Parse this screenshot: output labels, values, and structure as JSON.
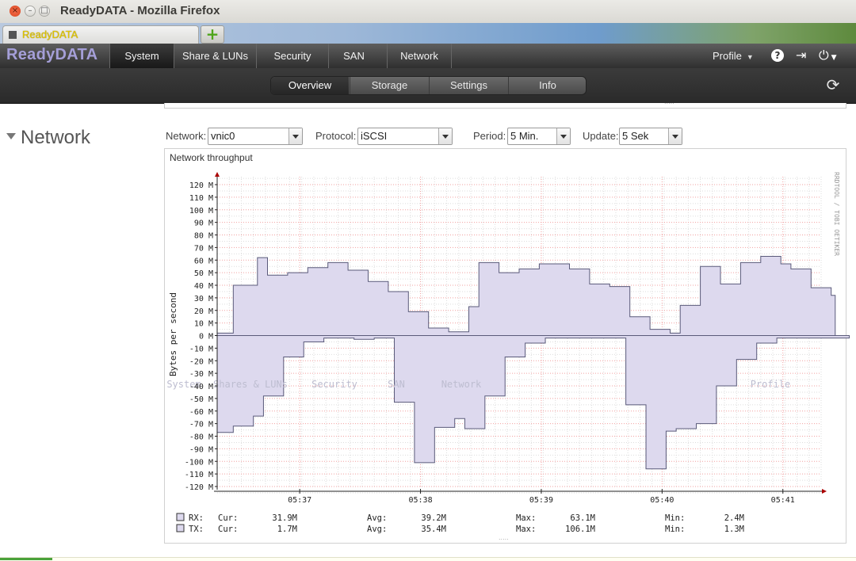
{
  "window": {
    "title": "ReadyDATA - Mozilla Firefox",
    "close_icon": "×",
    "min_icon": "–",
    "max_icon": "□"
  },
  "browser": {
    "tab_label": "ReadyDATA",
    "new_tab_icon": "+"
  },
  "app": {
    "logo": "ReadyDATA",
    "nav": [
      {
        "label": "System",
        "active": true
      },
      {
        "label": "Share & LUNs",
        "active": false
      },
      {
        "label": "Security",
        "active": false
      },
      {
        "label": "SAN",
        "active": false
      },
      {
        "label": "Network",
        "active": false
      }
    ],
    "profile_label": "Profile",
    "icons": {
      "help": "?",
      "logout": "⇥",
      "power": "⏻",
      "refresh": "⟳"
    }
  },
  "subnav": [
    {
      "label": "Overview",
      "active": true
    },
    {
      "label": "Storage",
      "active": false
    },
    {
      "label": "Settings",
      "active": false
    },
    {
      "label": "Info",
      "active": false
    }
  ],
  "section": {
    "title": "Network"
  },
  "controls": {
    "network": {
      "label": "Network:",
      "value": "vnic0"
    },
    "protocol": {
      "label": "Protocol:",
      "value": "iSCSI"
    },
    "period": {
      "label": "Period:",
      "value": "5 Min."
    },
    "update": {
      "label": "Update:",
      "value": "5 Sek"
    }
  },
  "graph": {
    "title": "Network throughput",
    "side_label": "RRDTOOL / TOBI OETIKER",
    "grip": "....."
  },
  "chart_data": {
    "type": "area",
    "ylabel": "Bytes per second",
    "ylim": [
      -125,
      125
    ],
    "y_ticks": [
      120,
      110,
      100,
      90,
      80,
      70,
      60,
      50,
      40,
      30,
      20,
      10,
      0,
      -10,
      -20,
      -30,
      -40,
      -50,
      -60,
      -70,
      -80,
      -90,
      -100,
      -110,
      -120
    ],
    "y_tick_suffix": " M",
    "x_range": [
      0,
      300
    ],
    "x_ticks": [
      {
        "x": 41,
        "label": "05:37"
      },
      {
        "x": 101,
        "label": "05:38"
      },
      {
        "x": 161,
        "label": "05:39"
      },
      {
        "x": 221,
        "label": "05:40"
      },
      {
        "x": 281,
        "label": "05:41"
      }
    ],
    "fill_color": "#ddd9ee",
    "line_color": "#5a5a7a",
    "series": [
      {
        "name": "RX",
        "values": [
          2,
          2,
          2,
          2,
          2,
          2,
          2,
          2,
          40,
          40,
          40,
          40,
          40,
          40,
          40,
          40,
          40,
          40,
          40,
          40,
          62,
          62,
          62,
          62,
          62,
          48,
          48,
          48,
          48,
          48,
          48,
          48,
          48,
          48,
          48,
          50,
          50,
          50,
          50,
          50,
          50,
          50,
          50,
          50,
          50,
          54,
          54,
          54,
          54,
          54,
          54,
          54,
          54,
          54,
          54,
          58,
          58,
          58,
          58,
          58,
          58,
          58,
          58,
          58,
          58,
          52,
          52,
          52,
          52,
          52,
          52,
          52,
          52,
          52,
          52,
          43,
          43,
          43,
          43,
          43,
          43,
          43,
          43,
          43,
          43,
          35,
          35,
          35,
          35,
          35,
          35,
          35,
          35,
          35,
          35,
          19,
          19,
          19,
          19,
          19,
          19,
          19,
          19,
          19,
          19,
          6,
          6,
          6,
          6,
          6,
          6,
          6,
          6,
          6,
          6,
          3,
          3,
          3,
          3,
          3,
          3,
          3,
          3,
          3,
          3,
          23,
          23,
          23,
          23,
          23,
          58,
          58,
          58,
          58,
          58,
          58,
          58,
          58,
          58,
          58,
          50,
          50,
          50,
          50,
          50,
          50,
          50,
          50,
          50,
          50,
          53,
          53,
          53,
          53,
          53,
          53,
          53,
          53,
          53,
          53,
          57,
          57,
          57,
          57,
          57,
          57,
          57,
          57,
          57,
          57,
          57,
          57,
          57,
          57,
          57,
          53,
          53,
          53,
          53,
          53,
          53,
          53,
          53,
          53,
          53,
          41,
          41,
          41,
          41,
          41,
          41,
          41,
          41,
          41,
          41,
          39,
          39,
          39,
          39,
          39,
          39,
          39,
          39,
          39,
          39,
          15,
          15,
          15,
          15,
          15,
          15,
          15,
          15,
          15,
          15,
          5,
          5,
          5,
          5,
          5,
          5,
          5,
          5,
          5,
          5,
          2,
          2,
          2,
          2,
          2,
          24,
          24,
          24,
          24,
          24,
          24,
          24,
          24,
          24,
          24,
          55,
          55,
          55,
          55,
          55,
          55,
          55,
          55,
          55,
          55,
          41,
          41,
          41,
          41,
          41,
          41,
          41,
          41,
          41,
          41,
          58,
          58,
          58,
          58,
          58,
          58,
          58,
          58,
          58,
          58,
          63,
          63,
          63,
          63,
          63,
          63,
          63,
          63,
          63,
          63,
          57,
          57,
          57,
          57,
          57,
          53,
          53,
          53,
          53,
          53,
          53,
          53,
          53,
          53,
          53,
          38,
          38,
          38,
          38,
          38,
          38,
          38,
          38,
          38,
          38,
          32,
          32
        ]
      },
      {
        "name": "TX",
        "values": [
          77,
          77,
          77,
          77,
          77,
          77,
          77,
          77,
          72,
          72,
          72,
          72,
          72,
          72,
          72,
          72,
          72,
          72,
          64,
          64,
          64,
          64,
          64,
          48,
          48,
          48,
          48,
          48,
          48,
          48,
          48,
          48,
          48,
          17,
          17,
          17,
          17,
          17,
          17,
          17,
          17,
          17,
          17,
          5,
          5,
          5,
          5,
          5,
          5,
          5,
          5,
          5,
          5,
          2,
          2,
          2,
          2,
          2,
          2,
          2,
          2,
          2,
          2,
          2,
          2,
          2,
          2,
          2,
          3,
          3,
          3,
          3,
          3,
          3,
          3,
          3,
          3,
          3,
          2,
          2,
          2,
          2,
          2,
          2,
          2,
          2,
          2,
          2,
          53,
          53,
          53,
          53,
          53,
          53,
          53,
          53,
          53,
          53,
          101,
          101,
          101,
          101,
          101,
          101,
          101,
          101,
          101,
          101,
          73,
          73,
          73,
          73,
          73,
          73,
          73,
          73,
          73,
          73,
          66,
          66,
          66,
          66,
          66,
          74,
          74,
          74,
          74,
          74,
          74,
          74,
          74,
          74,
          74,
          48,
          48,
          48,
          48,
          48,
          48,
          48,
          48,
          48,
          48,
          17,
          17,
          17,
          17,
          17,
          17,
          17,
          17,
          17,
          17,
          6,
          6,
          6,
          6,
          6,
          6,
          6,
          6,
          6,
          6,
          2,
          2,
          2,
          2,
          2,
          2,
          2,
          2,
          2,
          2,
          2,
          2,
          2,
          2,
          2,
          2,
          2,
          2,
          2,
          2,
          2,
          2,
          2,
          2,
          2,
          2,
          2,
          2,
          2,
          2,
          2,
          2,
          2,
          2,
          2,
          2,
          2,
          2,
          2,
          2,
          55,
          55,
          55,
          55,
          55,
          55,
          55,
          55,
          55,
          55,
          106,
          106,
          106,
          106,
          106,
          106,
          106,
          106,
          106,
          106,
          76,
          76,
          76,
          76,
          76,
          74,
          74,
          74,
          74,
          74,
          74,
          74,
          74,
          74,
          74,
          70,
          70,
          70,
          70,
          70,
          70,
          70,
          70,
          70,
          70,
          40,
          40,
          40,
          40,
          40,
          40,
          40,
          40,
          40,
          40,
          19,
          19,
          19,
          19,
          19,
          19,
          19,
          19,
          19,
          19,
          6,
          6,
          6,
          6,
          6,
          6,
          6,
          6,
          6,
          6,
          2,
          2,
          2,
          2,
          2,
          2,
          2,
          2,
          2,
          2,
          2,
          2,
          2,
          2,
          2,
          2,
          2,
          2,
          2,
          2,
          2,
          2,
          2,
          2,
          2,
          2,
          2,
          2,
          2,
          2,
          2,
          2,
          2,
          2,
          2,
          2
        ]
      }
    ],
    "legend": [
      {
        "name": "RX:",
        "cur_label": "Cur:",
        "cur": "31.9M",
        "avg_label": "Avg:",
        "avg": "39.2M",
        "max_label": "Max:",
        "max": "63.1M",
        "min_label": "Min:",
        "min": "2.4M"
      },
      {
        "name": "TX:",
        "cur_label": "Cur:",
        "cur": "1.7M",
        "avg_label": "Avg:",
        "avg": "35.4M",
        "max_label": "Max:",
        "max": "106.1M",
        "min_label": "Min:",
        "min": "1.3M"
      }
    ],
    "ghost_labels": [
      "System",
      "Shares & LUNs",
      "Security",
      "SAN",
      "Network",
      "Profile"
    ]
  }
}
